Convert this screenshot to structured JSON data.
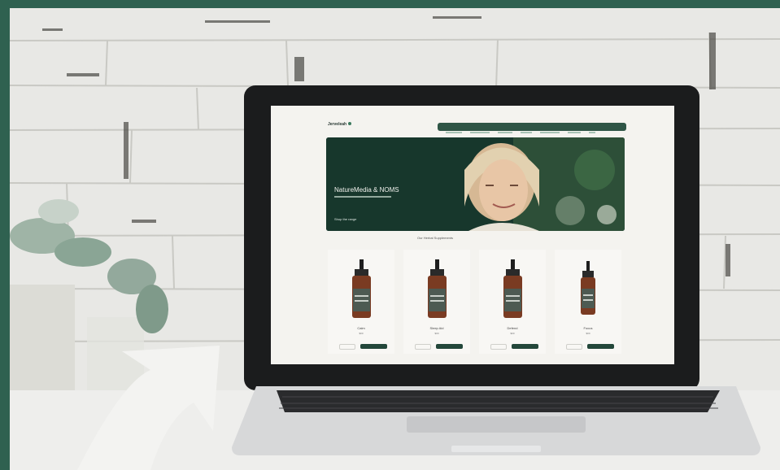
{
  "scene": {
    "frame_color": "#2f6150",
    "wall_color": "#e9e9e6",
    "arrow_color": "#f3f3f1",
    "laptop_color": "#1b1c1d"
  },
  "website": {
    "logo": "Jerveleah",
    "hero_title": "NatureMedia & NOMS",
    "hero_link": "Shop the range",
    "products_heading": "Our Herbal Supplements",
    "products": [
      {
        "name": "Calm",
        "price": "$00"
      },
      {
        "name": "Sleep Aid",
        "price": "$00"
      },
      {
        "name": "Defend",
        "price": "$00"
      },
      {
        "name": "Focus",
        "price": "$00"
      }
    ]
  }
}
